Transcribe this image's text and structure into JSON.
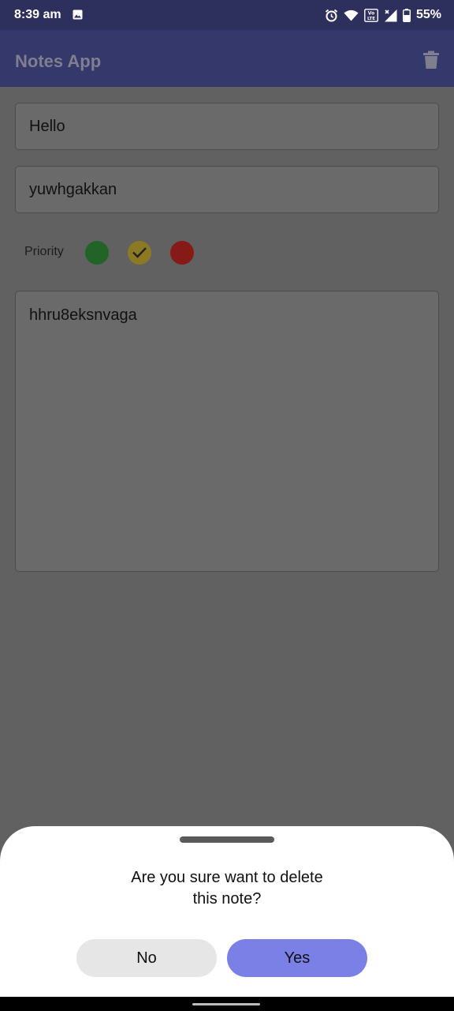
{
  "status_bar": {
    "time": "8:39 am",
    "battery_percent": "55%",
    "icons": [
      "image-notification-icon",
      "alarm-icon",
      "wifi-icon",
      "volte-icon",
      "cellular-signal-icon",
      "battery-icon"
    ]
  },
  "app_bar": {
    "title": "Notes App",
    "action_icon": "trash-icon"
  },
  "note": {
    "title_value": "Hello",
    "subtitle_value": "yuwhgakkan",
    "priority_label": "Priority",
    "priority_options": [
      {
        "name": "green",
        "color": "#2e7d32",
        "selected": false
      },
      {
        "name": "yellow",
        "color": "#c8a82e",
        "selected": true
      },
      {
        "name": "red",
        "color": "#c62828",
        "selected": false
      }
    ],
    "body_value": "hhru8eksnvaga"
  },
  "dialog": {
    "message_line1": "Are you sure want to delete",
    "message_line2": "this note?",
    "no_label": "No",
    "yes_label": "Yes",
    "yes_color": "#7a80e6"
  },
  "colors": {
    "status_bar": "#2d2f5d",
    "app_bar": "#34386b",
    "scrim_background": "#616161"
  }
}
